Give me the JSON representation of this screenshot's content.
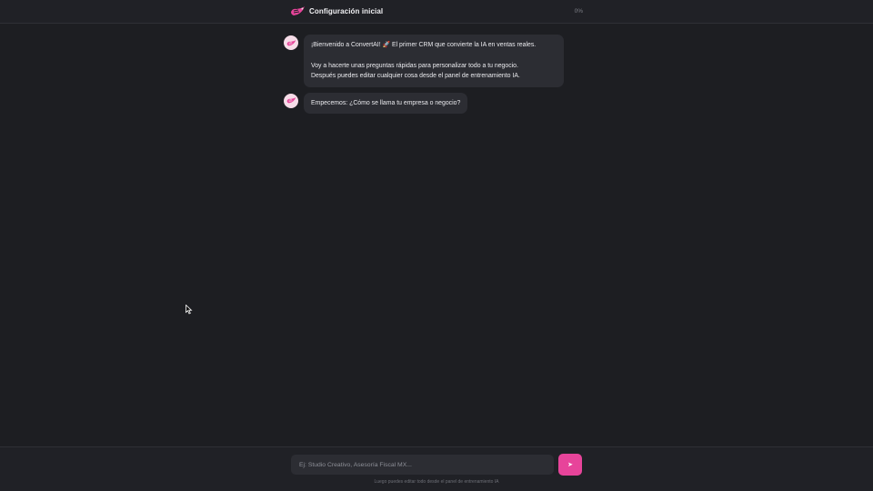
{
  "header": {
    "title": "Configuración inicial",
    "progress": "0%",
    "logo_icon": "rocket-hand-logo"
  },
  "messages": [
    {
      "lines": [
        "¡Bienvenido a ConvertAI! 🚀 El primer CRM que convierte la IA en ventas reales.",
        "",
        "Voy a hacerte unas preguntas rápidas para personalizar todo a tu negocio.",
        "Después puedes editar cualquier cosa desde el panel de entrenamiento IA."
      ]
    },
    {
      "lines": [
        "Empecemos: ¿Cómo se llama tu empresa o negocio?"
      ]
    }
  ],
  "composer": {
    "placeholder": "Ej: Studio Creativo, Asesoría Fiscal MX...",
    "value": "",
    "send_label": "➤",
    "note": "Luego puedes editar todo desde el panel de entrenamiento IA"
  },
  "colors": {
    "accent": "#e7449a",
    "background": "#1d1e22",
    "bubble": "#2c2d33",
    "avatar": "#f6dce8"
  }
}
